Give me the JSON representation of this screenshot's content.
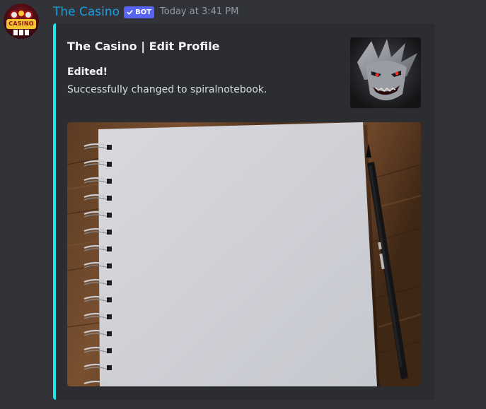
{
  "message": {
    "author": {
      "name": "The Casino",
      "badge": "BOT",
      "avatar_logo_text": "CASINO"
    },
    "timestamp": "Today at 3:41 PM"
  },
  "embed": {
    "accent_color": "#1fe4e8",
    "title": "The Casino | Edit Profile",
    "field": {
      "name": "Edited!",
      "value": "Successfully changed to spiralnotebook."
    },
    "thumbnail_icon": "joker-face-icon",
    "image_description_icon": "spiral-notebook-image",
    "pen_label": "OS"
  }
}
